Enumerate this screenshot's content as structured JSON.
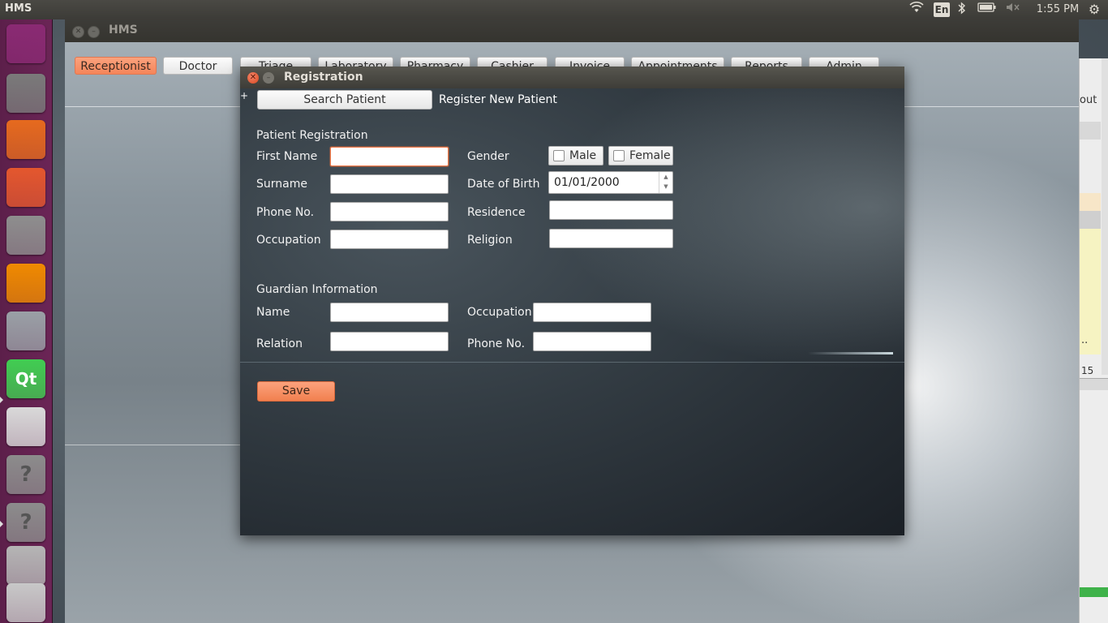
{
  "top_panel": {
    "app_title": "HMS",
    "language": "En",
    "clock": "1:55 PM",
    "icons": [
      "wifi-icon",
      "keyboard-layout-icon",
      "bluetooth-icon",
      "battery-icon",
      "volume-muted-icon",
      "settings-gear-icon"
    ]
  },
  "launcher": {
    "items": [
      {
        "name": "ubuntu-dash-icon",
        "color": "#8a2a73"
      },
      {
        "name": "files-icon",
        "color": "#7a7a7a"
      },
      {
        "name": "firefox-icon",
        "color": "#e66a1e"
      },
      {
        "name": "software-center-icon",
        "color": "#e4572e"
      },
      {
        "name": "system-settings-icon",
        "color": "#8e8e8e"
      },
      {
        "name": "vlc-icon",
        "color": "#f08a00"
      },
      {
        "name": "database-icon",
        "color": "#9aa0a6"
      },
      {
        "name": "qt-creator-icon",
        "color": "#41cd52",
        "label": "Qt"
      },
      {
        "name": "text-editor-icon",
        "color": "#d9d9d9"
      },
      {
        "name": "unknown-app-icon",
        "color": "#8c8c8c",
        "label": "?"
      },
      {
        "name": "unknown-app-icon",
        "color": "#8c8c8c",
        "label": "?"
      },
      {
        "name": "drive-icon",
        "color": "#b5b5b5"
      },
      {
        "name": "removable-drive-icon",
        "color": "#c8c8c8"
      }
    ]
  },
  "hms_window": {
    "title": "HMS",
    "tabs": [
      {
        "label": "Receptionist",
        "active": true
      },
      {
        "label": "Doctor",
        "active": false
      },
      {
        "label": "Triage",
        "active": false
      },
      {
        "label": "Laboratory",
        "active": false
      },
      {
        "label": "Pharmacy",
        "active": false
      },
      {
        "label": "Cashier",
        "active": false
      },
      {
        "label": "Invoice",
        "active": false
      },
      {
        "label": "Appointments",
        "active": false
      },
      {
        "label": "Reports",
        "active": false
      },
      {
        "label": "Admin",
        "active": false
      }
    ]
  },
  "edge_window": {
    "text1": "out",
    "text2": "..",
    "text3": "15"
  },
  "registration": {
    "title": "Registration",
    "plus": "+",
    "tab_search": "Search Patient",
    "tab_register": "Register New Patient",
    "patient_section": "Patient Registration",
    "first_name_label": "First Name",
    "first_name_value": "",
    "surname_label": "Surname",
    "surname_value": "",
    "phone_label": "Phone No.",
    "phone_value": "",
    "occupation_label": "Occupation",
    "occupation_value": "",
    "gender_label": "Gender",
    "gender_male": "Male",
    "gender_female": "Female",
    "dob_label": "Date of Birth",
    "dob_value": "01/01/2000",
    "residence_label": "Residence",
    "residence_value": "",
    "religion_label": "Religion",
    "religion_value": "",
    "guardian_section": "Guardian Information",
    "g_name_label": "Name",
    "g_name_value": "",
    "g_occupation_label": "Occupation",
    "g_occupation_value": "",
    "g_relation_label": "Relation",
    "g_relation_value": "",
    "g_phone_label": "Phone No.",
    "g_phone_value": "",
    "save_label": "Save",
    "accent_color": "#f5855a"
  }
}
